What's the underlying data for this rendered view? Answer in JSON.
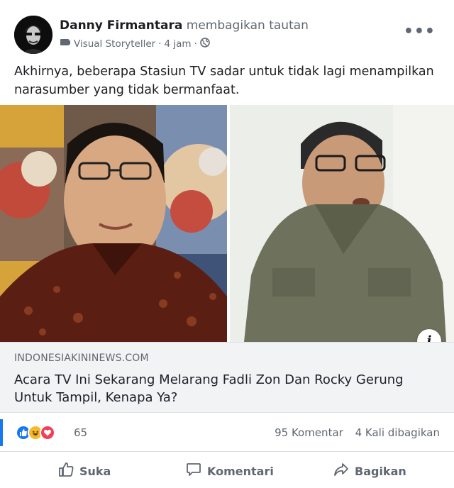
{
  "post": {
    "author": "Danny Firmantara",
    "action": "membagikan tautan",
    "page": "Visual Storyteller",
    "separator": "·",
    "time": "4 jam",
    "more_label": "•••",
    "text": "Akhirnya, beberapa Stasiun TV sadar untuk tidak lagi menampilkan narasumber yang tidak bermanfaat."
  },
  "link": {
    "domain": "INDONESIAKININEWS.COM",
    "title": "Acara TV Ini Sekarang Melarang Fadli Zon Dan Rocky Gerung Untuk Tampil, Kenapa Ya?",
    "info_label": "i"
  },
  "stats": {
    "reaction_icons": [
      "like-icon",
      "haha-icon",
      "love-icon"
    ],
    "reaction_count": "65",
    "comments": "95 Komentar",
    "shares": "4 Kali dibagikan"
  },
  "actions": {
    "like": "Suka",
    "comment": "Komentari",
    "share": "Bagikan"
  },
  "colors": {
    "like_blue": "#1877f2",
    "love_red": "#f33e58",
    "haha_yellow": "#f7b928",
    "muted_text": "#606770"
  }
}
